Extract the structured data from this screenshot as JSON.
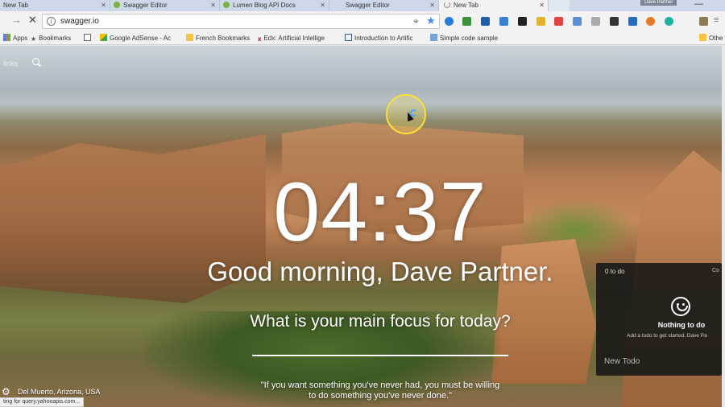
{
  "tabs": [
    {
      "label": "New Tab",
      "active": false
    },
    {
      "label": "Swagger Editor",
      "active": false
    },
    {
      "label": "Lumen Blog API Docs",
      "active": false
    },
    {
      "label": "Swagger Editor",
      "active": false
    },
    {
      "label": "New Tab",
      "active": true
    }
  ],
  "profile_name": "Dave Partner",
  "toolbar": {
    "url": "swagger.io"
  },
  "bookmarks": [
    {
      "label": "Apps",
      "icon": "apps-icon"
    },
    {
      "label": "Bookmarks",
      "icon": "star-icon"
    },
    {
      "label": "",
      "icon": "document-icon"
    },
    {
      "label": "Google AdSense - Ac",
      "icon": "adsense-icon"
    },
    {
      "label": "French Bookmarks",
      "icon": "folder-icon"
    },
    {
      "label": "Edx: Artificial Intellige",
      "icon": "edx-icon"
    },
    {
      "label": "Introduction to Artific",
      "icon": "link-icon"
    },
    {
      "label": "Simple code sample",
      "icon": "grid-icon"
    },
    {
      "label": "Othe",
      "icon": "folder-icon"
    }
  ],
  "momentum": {
    "links_label": "links",
    "clock": "04:37",
    "greeting": "Good morning, Dave Partner.",
    "focus_question": "What is your main focus for today?",
    "quote": "\"If you want something you've never had, you must be willing to do something you've never done.\"",
    "location": "Del Muerto, Arizona, USA"
  },
  "todo": {
    "count_label": "0 to do",
    "corner_label": "Co",
    "empty_title": "Nothing to do",
    "empty_subtitle": "Add a todo to get started, Dave Pa",
    "new_todo_placeholder": "New Todo"
  },
  "status_text": "ting for query.yahooapis.com...",
  "colors": {
    "tabstrip": "#cdd9e8",
    "toolbar": "#f2f2f2",
    "star": "#4a86e8",
    "cursor_highlight": "#ffe135"
  }
}
